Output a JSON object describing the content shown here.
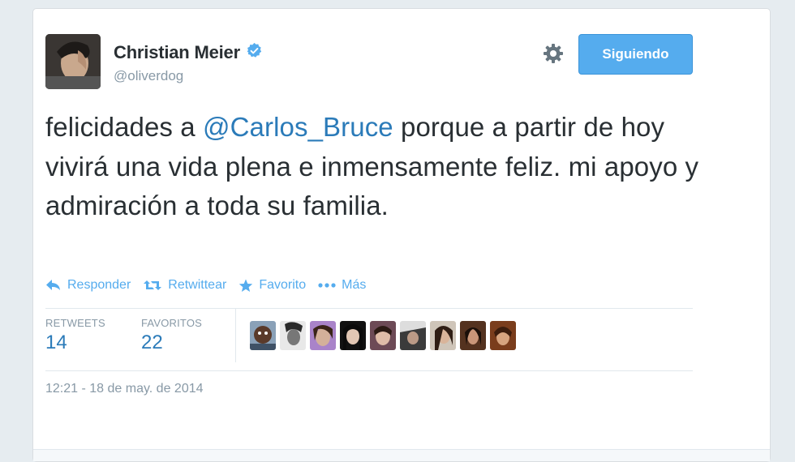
{
  "user": {
    "display_name": "Christian Meier",
    "handle": "@oliverdog",
    "verified_icon": "verified-badge-icon"
  },
  "follow_button": {
    "label": "Siguiendo"
  },
  "settings_icon": "gear-icon",
  "tweet": {
    "text_before": "felicidades a ",
    "mention": "@Carlos_Bruce",
    "text_after": " porque a partir de hoy vivirá una vida plena e inmensamente feliz.  mi apoyo y admiración a toda su familia."
  },
  "actions": [
    {
      "label": "Responder",
      "icon": "reply-icon"
    },
    {
      "label": "Retwittear",
      "icon": "retweet-icon"
    },
    {
      "label": "Favorito",
      "icon": "star-icon"
    },
    {
      "label": "Más",
      "icon": "more-dots-icon"
    }
  ],
  "stats": {
    "retweets": {
      "label": "RETWEETS",
      "value": "14"
    },
    "favorites": {
      "label": "FAVORITOS",
      "value": "22"
    }
  },
  "timestamp": "12:21 - 18 de may. de 2014",
  "colors": {
    "link": "#2b7bb9",
    "action": "#55acee",
    "button": "#55acee",
    "muted": "#8899a6",
    "text": "#292f33"
  }
}
